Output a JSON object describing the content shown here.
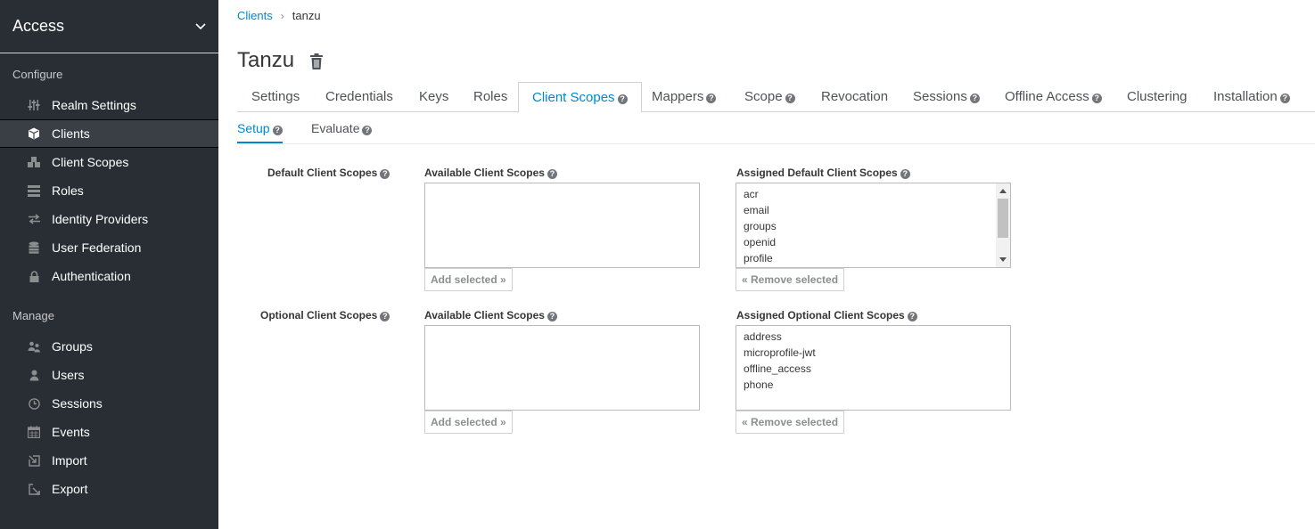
{
  "sidebar": {
    "realm": "Access",
    "sections": {
      "configure": "Configure",
      "manage": "Manage"
    },
    "configure_items": [
      {
        "label": "Realm Settings",
        "icon": "sliders-icon"
      },
      {
        "label": "Clients",
        "icon": "cube-icon",
        "active": true
      },
      {
        "label": "Client Scopes",
        "icon": "cubes-icon"
      },
      {
        "label": "Roles",
        "icon": "list-icon"
      },
      {
        "label": "Identity Providers",
        "icon": "exchange-icon"
      },
      {
        "label": "User Federation",
        "icon": "database-icon"
      },
      {
        "label": "Authentication",
        "icon": "lock-icon"
      }
    ],
    "manage_items": [
      {
        "label": "Groups",
        "icon": "users-icon"
      },
      {
        "label": "Users",
        "icon": "user-icon"
      },
      {
        "label": "Sessions",
        "icon": "clock-icon"
      },
      {
        "label": "Events",
        "icon": "calendar-icon"
      },
      {
        "label": "Import",
        "icon": "import-icon"
      },
      {
        "label": "Export",
        "icon": "export-icon"
      }
    ]
  },
  "breadcrumb": {
    "parent": "Clients",
    "separator": "›",
    "current": "tanzu"
  },
  "page": {
    "title": "Tanzu"
  },
  "tabs": [
    {
      "label": "Settings"
    },
    {
      "label": "Credentials"
    },
    {
      "label": "Keys"
    },
    {
      "label": "Roles"
    },
    {
      "label": "Client Scopes",
      "help": true,
      "active": true
    },
    {
      "label": "Mappers",
      "help": true
    },
    {
      "label": "Scope",
      "help": true
    },
    {
      "label": "Revocation"
    },
    {
      "label": "Sessions",
      "help": true
    },
    {
      "label": "Offline Access",
      "help": true
    },
    {
      "label": "Clustering"
    },
    {
      "label": "Installation",
      "help": true
    }
  ],
  "subtabs": [
    {
      "label": "Setup",
      "active": true
    },
    {
      "label": "Evaluate"
    }
  ],
  "default_scopes": {
    "row_label": "Default Client Scopes",
    "available_label": "Available Client Scopes",
    "assigned_label": "Assigned Default Client Scopes",
    "available": [],
    "assigned": [
      "acr",
      "email",
      "groups",
      "openid",
      "profile"
    ],
    "add_button": "Add selected »",
    "remove_button": "« Remove selected"
  },
  "optional_scopes": {
    "row_label": "Optional Client Scopes",
    "available_label": "Available Client Scopes",
    "assigned_label": "Assigned Optional Client Scopes",
    "available": [],
    "assigned": [
      "address",
      "microprofile-jwt",
      "offline_access",
      "phone"
    ],
    "add_button": "Add selected »",
    "remove_button": "« Remove selected"
  },
  "help_glyph": "?",
  "colors": {
    "sidebar_bg": "#292e34",
    "accent": "#0088ce"
  }
}
